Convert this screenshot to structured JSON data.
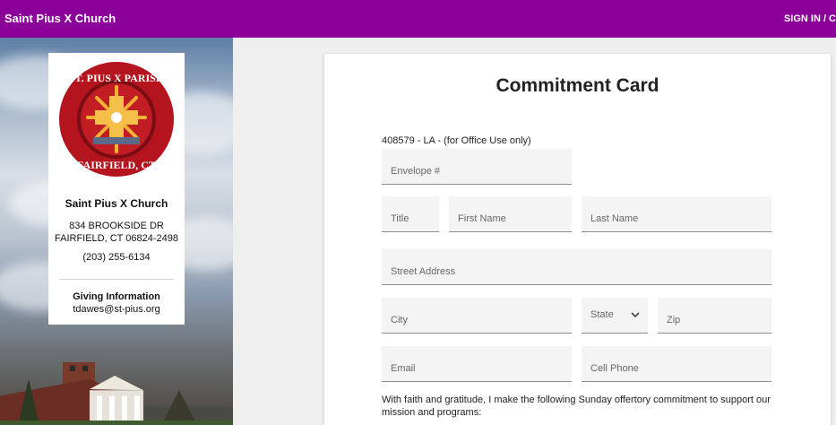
{
  "header": {
    "brand": "Saint Pius X Church",
    "signin": "SIGN IN / C"
  },
  "sidebar": {
    "seal_text": "ST. PIUS X PARISH FAIRFIELD, CT",
    "church_name": "Saint Pius X Church",
    "address_line1": "834 BROOKSIDE DR",
    "address_line2": "FAIRFIELD, CT 06824-2498",
    "phone": "(203) 255-6134",
    "giving_heading": "Giving Information",
    "giving_email": "tdawes@st-pius.org"
  },
  "form": {
    "title": "Commitment Card",
    "office_use": "408579 - LA     - (for Office Use only)",
    "fields": {
      "envelope": "Envelope #",
      "title": "Title",
      "first_name": "First Name",
      "last_name": "Last Name",
      "street": "Street Address",
      "city": "City",
      "state": "State",
      "zip": "Zip",
      "email": "Email",
      "cell": "Cell Phone"
    },
    "statement": "With faith and gratitude, I make the following Sunday offertory commitment to support our mission and programs:"
  },
  "colors": {
    "header": "#8a0099",
    "seal_red": "#b3141e",
    "seal_gold": "#f2b233"
  }
}
